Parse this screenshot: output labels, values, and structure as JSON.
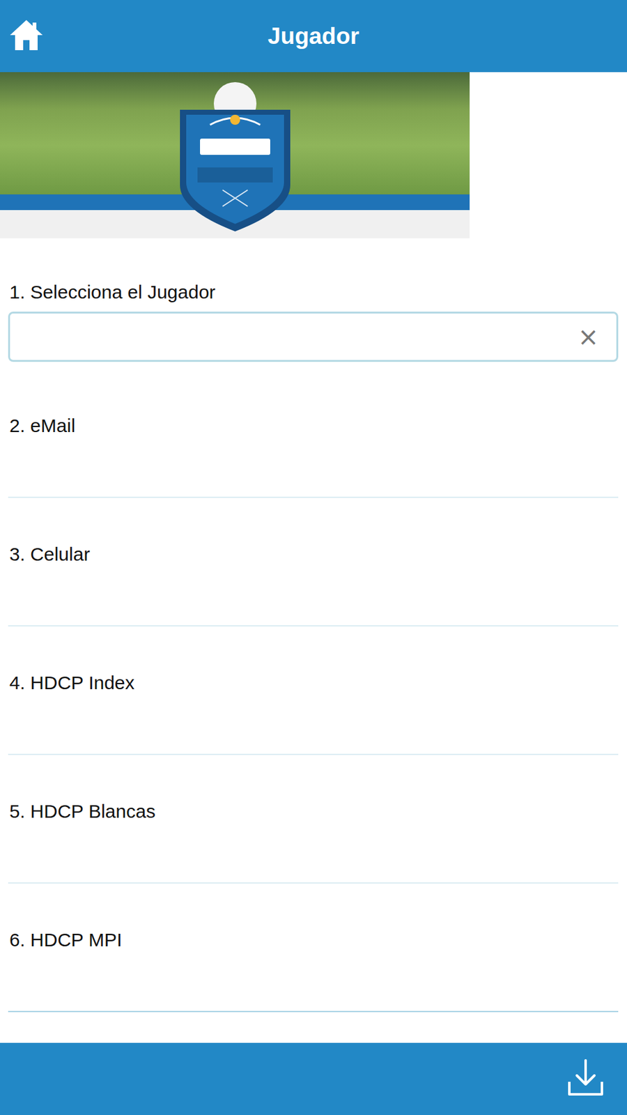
{
  "header": {
    "title": "Jugador"
  },
  "player_select": {
    "label": "1. Selecciona el Jugador",
    "value": "",
    "clear": "×"
  },
  "fields": [
    {
      "label": "2. eMail",
      "value": ""
    },
    {
      "label": "3. Celular",
      "value": ""
    },
    {
      "label": "4. HDCP Index",
      "value": ""
    },
    {
      "label": "5. HDCP Blancas",
      "value": ""
    },
    {
      "label": "6. HDCP MPI",
      "value": ""
    }
  ]
}
